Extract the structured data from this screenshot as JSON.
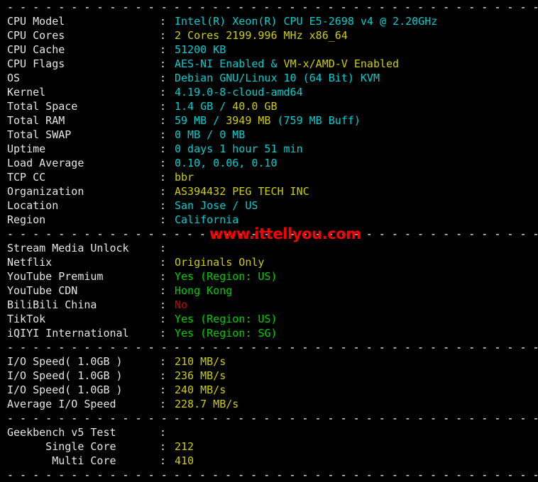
{
  "terminal": {
    "separator_char": "- ",
    "separator_repeat": 58,
    "watermark": "www.ittellyou.com",
    "colors": {
      "background": "#000000",
      "foreground": "#e6e6e6",
      "cyan": "#00cdcd",
      "yellow": "#cdcd00",
      "green": "#00cd00",
      "red": "#cd0000",
      "watermark": "#fa0000",
      "separator": "#ffffff"
    }
  },
  "sections": [
    {
      "name": "system-info",
      "rows": [
        {
          "label": "CPU Model",
          "parts": [
            {
              "text": "Intel(R) Xeon(R) CPU E5-2698 v4 @ 2.20GHz",
              "color": "cyan"
            }
          ]
        },
        {
          "label": "CPU Cores",
          "parts": [
            {
              "text": "2 Cores 2199.996 MHz x86_64",
              "color": "yellow"
            }
          ]
        },
        {
          "label": "CPU Cache",
          "parts": [
            {
              "text": "51200 KB",
              "color": "cyan"
            }
          ]
        },
        {
          "label": "CPU Flags",
          "parts": [
            {
              "text": "AES-NI Enabled & ",
              "color": "cyan"
            },
            {
              "text": "VM-x/AMD-V Enabled",
              "color": "yellow"
            }
          ]
        },
        {
          "label": "OS",
          "parts": [
            {
              "text": "Debian GNU/Linux 10 (64 Bit) KVM",
              "color": "cyan"
            }
          ]
        },
        {
          "label": "Kernel",
          "parts": [
            {
              "text": "4.19.0-8-cloud-amd64",
              "color": "cyan"
            }
          ]
        },
        {
          "label": "Total Space",
          "parts": [
            {
              "text": "1.4 GB / ",
              "color": "cyan"
            },
            {
              "text": "40.0 GB",
              "color": "yellow"
            }
          ]
        },
        {
          "label": "Total RAM",
          "parts": [
            {
              "text": "59 MB / ",
              "color": "cyan"
            },
            {
              "text": "3949 MB",
              "color": "yellow"
            },
            {
              "text": " (759 MB Buff)",
              "color": "cyan"
            }
          ]
        },
        {
          "label": "Total SWAP",
          "parts": [
            {
              "text": "0 MB / 0 MB",
              "color": "cyan"
            }
          ]
        },
        {
          "label": "Uptime",
          "parts": [
            {
              "text": "0 days 1 hour 51 min",
              "color": "cyan"
            }
          ]
        },
        {
          "label": "Load Average",
          "parts": [
            {
              "text": "0.10, 0.06, 0.10",
              "color": "cyan"
            }
          ]
        },
        {
          "label": "TCP CC",
          "parts": [
            {
              "text": "bbr",
              "color": "yellow"
            }
          ]
        },
        {
          "label": "Organization",
          "parts": [
            {
              "text": "AS394432 PEG TECH INC",
              "color": "yellow"
            }
          ]
        },
        {
          "label": "Location",
          "parts": [
            {
              "text": "San Jose / US",
              "color": "cyan"
            }
          ]
        },
        {
          "label": "Region",
          "parts": [
            {
              "text": "California",
              "color": "cyan"
            }
          ]
        }
      ]
    },
    {
      "name": "stream-media-unlock",
      "rows": [
        {
          "label": "Stream Media Unlock",
          "parts": []
        },
        {
          "label": "Netflix",
          "parts": [
            {
              "text": "Originals Only",
              "color": "yellow"
            }
          ]
        },
        {
          "label": "YouTube Premium",
          "parts": [
            {
              "text": "Yes (Region: US)",
              "color": "green"
            }
          ]
        },
        {
          "label": "YouTube CDN",
          "parts": [
            {
              "text": "Hong Kong",
              "color": "green"
            }
          ]
        },
        {
          "label": "BiliBili China",
          "parts": [
            {
              "text": "No",
              "color": "red"
            }
          ]
        },
        {
          "label": "TikTok",
          "parts": [
            {
              "text": "Yes (Region: US)",
              "color": "green"
            }
          ]
        },
        {
          "label": "iQIYI International",
          "parts": [
            {
              "text": "Yes (Region: SG)",
              "color": "green"
            }
          ]
        }
      ]
    },
    {
      "name": "io-speed",
      "rows": [
        {
          "label": "I/O Speed( 1.0GB )",
          "parts": [
            {
              "text": "210 MB/s",
              "color": "yellow"
            }
          ]
        },
        {
          "label": "I/O Speed( 1.0GB )",
          "parts": [
            {
              "text": "236 MB/s",
              "color": "yellow"
            }
          ]
        },
        {
          "label": "I/O Speed( 1.0GB )",
          "parts": [
            {
              "text": "240 MB/s",
              "color": "yellow"
            }
          ]
        },
        {
          "label": "Average I/O Speed",
          "parts": [
            {
              "text": "228.7 MB/s",
              "color": "yellow"
            }
          ]
        }
      ]
    },
    {
      "name": "geekbench-v5-test",
      "rows": [
        {
          "label": "Geekbench v5 Test",
          "parts": []
        },
        {
          "label": "      Single Core",
          "parts": [
            {
              "text": "212",
              "color": "yellow"
            }
          ]
        },
        {
          "label": "       Multi Core",
          "parts": [
            {
              "text": "410",
              "color": "yellow"
            }
          ]
        }
      ]
    }
  ]
}
